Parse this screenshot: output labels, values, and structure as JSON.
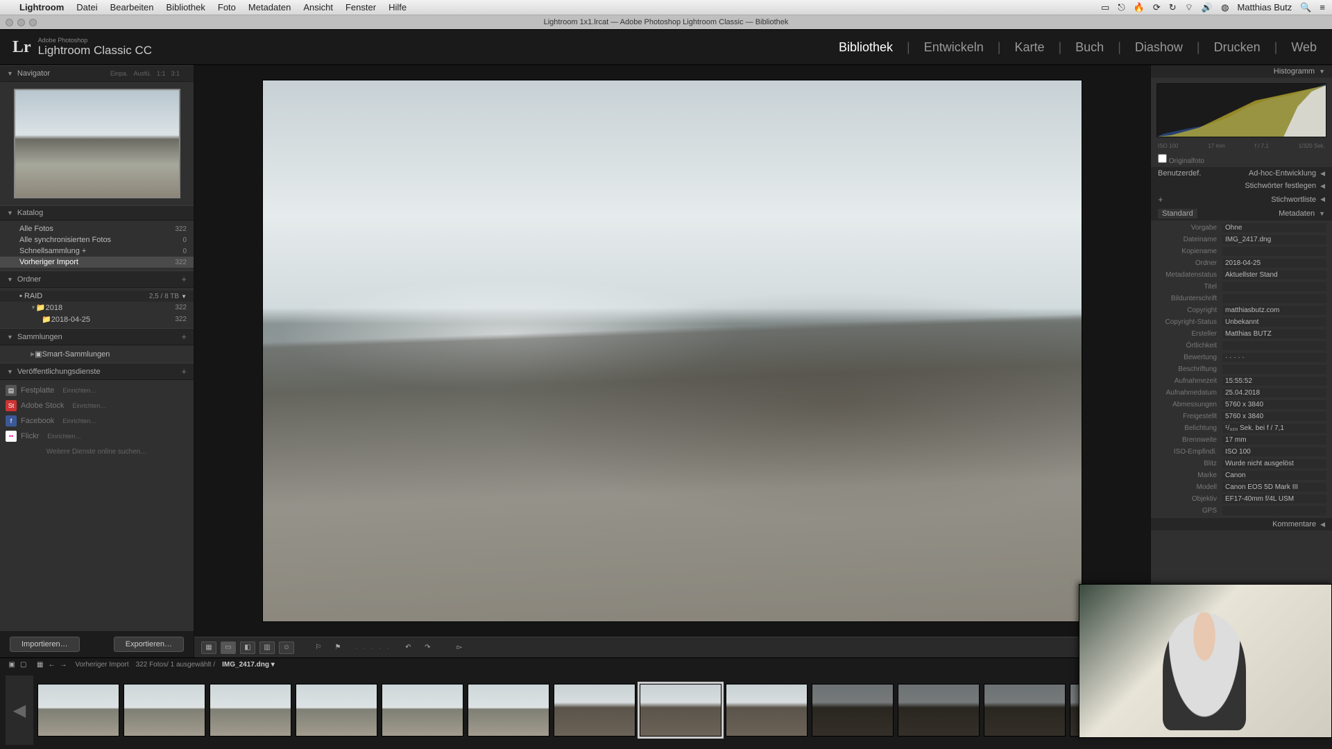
{
  "macmenu": {
    "app": "Lightroom",
    "items": [
      "Datei",
      "Bearbeiten",
      "Bibliothek",
      "Foto",
      "Metadaten",
      "Ansicht",
      "Fenster",
      "Hilfe"
    ],
    "user": "Matthias Butz"
  },
  "window": {
    "title": "Lightroom 1x1.lrcat — Adobe Photoshop Lightroom Classic — Bibliothek"
  },
  "brand": {
    "small": "Adobe Photoshop",
    "big": "Lightroom Classic CC"
  },
  "modules": [
    "Bibliothek",
    "Entwickeln",
    "Karte",
    "Buch",
    "Diashow",
    "Drucken",
    "Web"
  ],
  "modules_active": "Bibliothek",
  "navigator": {
    "title": "Navigator",
    "opts": [
      "Einpa.",
      "Ausfü.",
      "1:1",
      "3:1"
    ]
  },
  "katalog": {
    "title": "Katalog",
    "rows": [
      {
        "label": "Alle Fotos",
        "count": "322"
      },
      {
        "label": "Alle synchronisierten Fotos",
        "count": "0"
      },
      {
        "label": "Schnellsammlung  +",
        "count": "0"
      },
      {
        "label": "Vorheriger Import",
        "count": "322",
        "selected": true
      }
    ]
  },
  "ordner": {
    "title": "Ordner",
    "volume": {
      "name": "RAID",
      "free": "2,5 / 8 TB"
    },
    "tree": [
      {
        "label": "2018",
        "count": "322"
      },
      {
        "label": "2018-04-25",
        "count": "322",
        "indent": 1
      }
    ]
  },
  "sammlungen": {
    "title": "Sammlungen",
    "smart": "Smart-Sammlungen"
  },
  "publish": {
    "title": "Veröffentlichungsdienste",
    "rows": [
      {
        "icon": "hdd",
        "label": "Festplatte",
        "cfg": "Einrichten…",
        "color": "#555"
      },
      {
        "icon": "St",
        "label": "Adobe Stock",
        "cfg": "Einrichten…",
        "color": "#c33"
      },
      {
        "icon": "f",
        "label": "Facebook",
        "cfg": "Einrichten…",
        "color": "#3b5998"
      },
      {
        "icon": "••",
        "label": "Flickr",
        "cfg": "Einrichten…",
        "color": "#ff0084"
      }
    ],
    "more": "Weitere Dienste online suchen…"
  },
  "buttons": {
    "import": "Importieren…",
    "export": "Exportieren…"
  },
  "right": {
    "histogram": "Histogramm",
    "histo_info": {
      "iso": "ISO 100",
      "focal": "17 mm",
      "aperture": "f / 7,1",
      "shutter": "1/320 Sek."
    },
    "original": "Originalfoto",
    "userfield": "Benutzerdef.",
    "quickdev": "Ad-hoc-Entwicklung",
    "keywords_set": "Stichwörter festlegen",
    "keywords_list": "Stichwortliste",
    "metadata": "Metadaten",
    "metadata_mode": "Standard",
    "comments": "Kommentare"
  },
  "metadata": [
    {
      "lbl": "Vorgabe",
      "val": "Ohne"
    },
    {
      "lbl": "Dateiname",
      "val": "IMG_2417.dng"
    },
    {
      "lbl": "Kopiename",
      "val": ""
    },
    {
      "lbl": "Ordner",
      "val": "2018-04-25"
    },
    {
      "lbl": "Metadatenstatus",
      "val": "Aktuellster Stand"
    },
    {
      "lbl": "Titel",
      "val": ""
    },
    {
      "lbl": "Bildunterschrift",
      "val": ""
    },
    {
      "lbl": "Copyright",
      "val": "matthiasbutz.com"
    },
    {
      "lbl": "Copyright-Status",
      "val": "Unbekannt"
    },
    {
      "lbl": "Ersteller",
      "val": "Matthias BUTZ"
    },
    {
      "lbl": "Örtlichkeit",
      "val": ""
    },
    {
      "lbl": "Bewertung",
      "val": "·  ·  ·  ·  ·"
    },
    {
      "lbl": "Beschriftung",
      "val": ""
    },
    {
      "lbl": "Aufnahmezeit",
      "val": "15:55:52"
    },
    {
      "lbl": "Aufnahmedatum",
      "val": "25.04.2018"
    },
    {
      "lbl": "Abmessungen",
      "val": "5760 x 3840"
    },
    {
      "lbl": "Freigestellt",
      "val": "5760 x 3840"
    },
    {
      "lbl": "Belichtung",
      "val": "¹/₃₂₀ Sek. bei f / 7,1"
    },
    {
      "lbl": "Brennweite",
      "val": "17 mm"
    },
    {
      "lbl": "ISO-Empfindl.",
      "val": "ISO 100"
    },
    {
      "lbl": "Blitz",
      "val": "Wurde nicht ausgelöst"
    },
    {
      "lbl": "Marke",
      "val": "Canon"
    },
    {
      "lbl": "Modell",
      "val": "Canon EOS 5D Mark III"
    },
    {
      "lbl": "Objektiv",
      "val": "EF17-40mm f/4L USM"
    },
    {
      "lbl": "GPS",
      "val": ""
    }
  ],
  "stripinfo": {
    "source": "Vorheriger Import",
    "count": "322 Fotos/ 1 ausgewählt /",
    "file": "IMG_2417.dng ▾"
  }
}
